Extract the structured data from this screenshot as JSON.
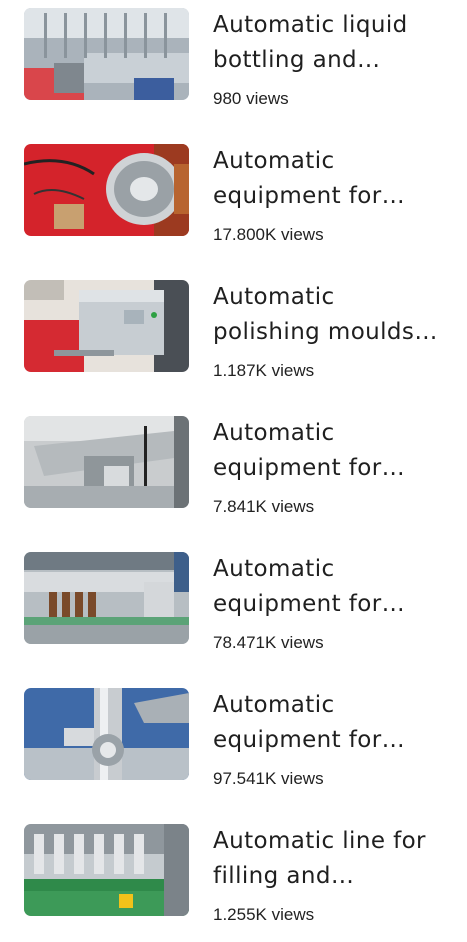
{
  "videos": [
    {
      "title": "Automatic liquid\nbottling and…",
      "views": "980 views",
      "thumb_icon": "bottling-machine-thumbnail"
    },
    {
      "title": "Automatic\nequipment for…",
      "views": "17.800K views",
      "thumb_icon": "stainless-pot-machine-thumbnail"
    },
    {
      "title": "Automatic\npolishing moulds…",
      "views": "1.187K views",
      "thumb_icon": "polishing-machine-thumbnail"
    },
    {
      "title": "Automatic\nequipment for…",
      "views": "7.841K views",
      "thumb_icon": "assembly-equipment-thumbnail"
    },
    {
      "title": "Automatic\nequipment for…",
      "views": "78.471K views",
      "thumb_icon": "conveyor-equipment-thumbnail"
    },
    {
      "title": "Automatic\nequipment for…",
      "views": "97.541K views",
      "thumb_icon": "stainless-tank-thumbnail"
    },
    {
      "title": "Automatic line for\nfilling and…",
      "views": "1.255K views",
      "thumb_icon": "filling-line-thumbnail"
    }
  ],
  "colors": {
    "text": "#1f1f1f",
    "background": "#ffffff"
  }
}
